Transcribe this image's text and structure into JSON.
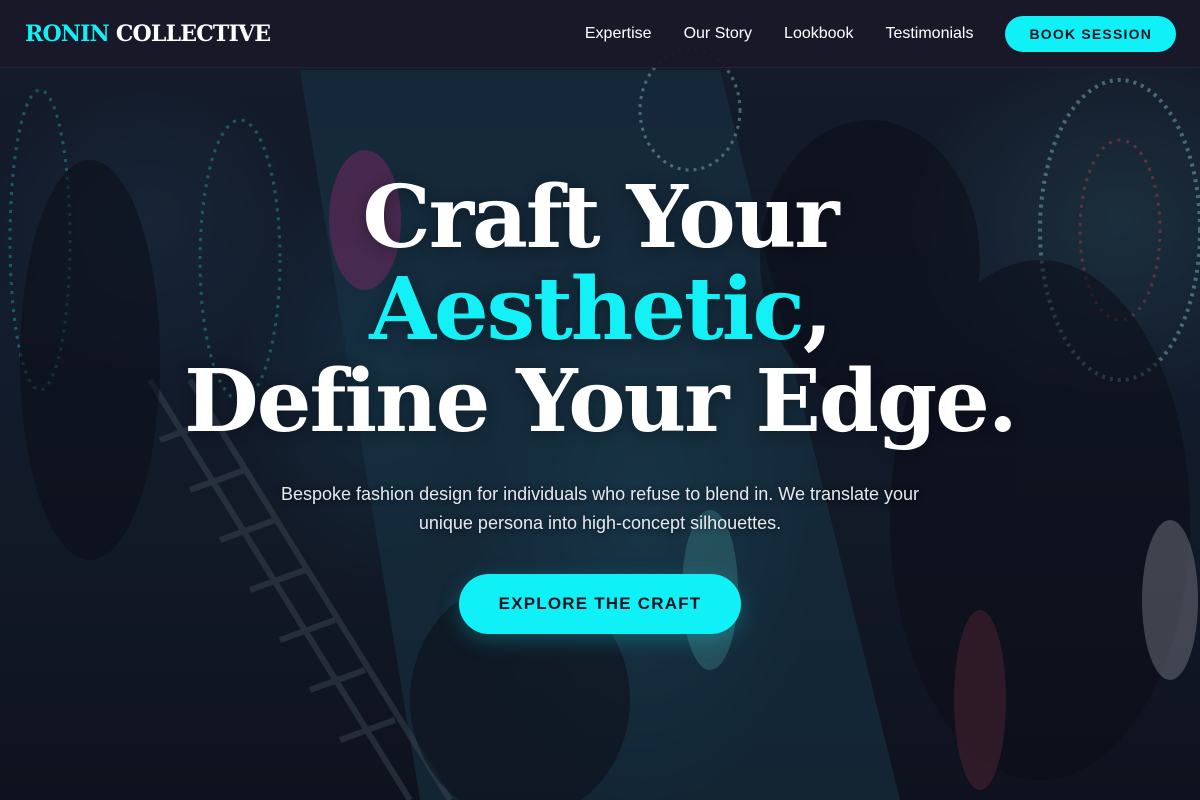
{
  "brand": {
    "name_part1": "RONIN",
    "name_part2": "COLLECTIVE",
    "accent_color": "#0ff1f7"
  },
  "nav": {
    "links": [
      {
        "label": "Expertise"
      },
      {
        "label": "Our Story"
      },
      {
        "label": "Lookbook"
      },
      {
        "label": "Testimonials"
      }
    ],
    "cta_label": "BOOK SESSION"
  },
  "hero": {
    "headline_line1": "Craft Your",
    "headline_accent": "Aesthetic",
    "headline_comma": ",",
    "headline_line3": "Define Your Edge.",
    "subtitle": "Bespoke fashion design for individuals who refuse to blend in. We translate your unique persona into high-concept silhouettes.",
    "cta_label": "EXPLORE THE CRAFT"
  }
}
